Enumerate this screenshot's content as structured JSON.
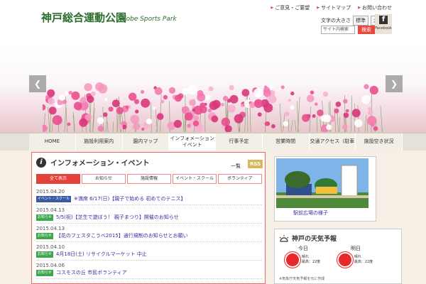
{
  "header": {
    "logo_jp": "神戸総合運動公園",
    "logo_en": "Kobe Sports Park",
    "util_links": [
      "ご意見・ご要望",
      "サイトマップ",
      "お問い合わせ"
    ],
    "font_size_label": "文字の大きさ",
    "font_size_standard": "標準",
    "font_size_large": "大",
    "facebook_label": "Facebook",
    "search_placeholder": "サイト内検索",
    "search_button": "検索"
  },
  "nav": {
    "items": [
      "HOME",
      "施設利用案内",
      "園内マップ",
      "インフォメーション イベント",
      "行事予定",
      "営業時間",
      "交通アクセス（駐車場）",
      "施設空き状況"
    ],
    "active_index": 3
  },
  "info": {
    "title": "インフォメーション・イベント",
    "list_link": "一覧",
    "rss": "RSS",
    "tabs": [
      "全て表示",
      "お知らせ",
      "施設情報",
      "イベント・スクール",
      "ボランティア"
    ],
    "active_tab": 0,
    "entries": [
      {
        "date": "2015.04.20",
        "badge": "イベント・スクール",
        "badge_type": "event",
        "text": "※満席 6/17(日)【親子で始める 初めてのテニス】"
      },
      {
        "date": "2015.04.13",
        "badge": "お知らせ",
        "badge_type": "notice",
        "text": "5/5(祝)【芝生で遊ぼう！ 親子まつり】開催のお知らせ"
      },
      {
        "date": "2015.04.13",
        "badge": "お知らせ",
        "badge_type": "notice",
        "text": "【花のフェスタこうべ2015】通行規制のお知らせとお願い"
      },
      {
        "date": "2015.04.10",
        "badge": "お知らせ",
        "badge_type": "notice",
        "text": "4月18日(土) リサイクルマーケット 中止"
      },
      {
        "date": "2015.04.06",
        "badge": "お知らせ",
        "badge_type": "notice",
        "text": "コスモスの丘 市民ボランティア"
      }
    ]
  },
  "photo": {
    "caption": "駅前広場の様子"
  },
  "weather": {
    "title": "神戸の天気予報",
    "today": {
      "label": "今日",
      "condition": "晴れ",
      "high": "最高：22度"
    },
    "tomorrow": {
      "label": "明日",
      "condition": "晴れ",
      "high": "最高：22度"
    },
    "note": "※気象庁天気予報を元に作成"
  },
  "colors": {
    "brand_green": "#2a6d2c",
    "accent_red": "#e3423b",
    "event_badge": "#3b5aa6",
    "notice_badge": "#3aa84b"
  }
}
